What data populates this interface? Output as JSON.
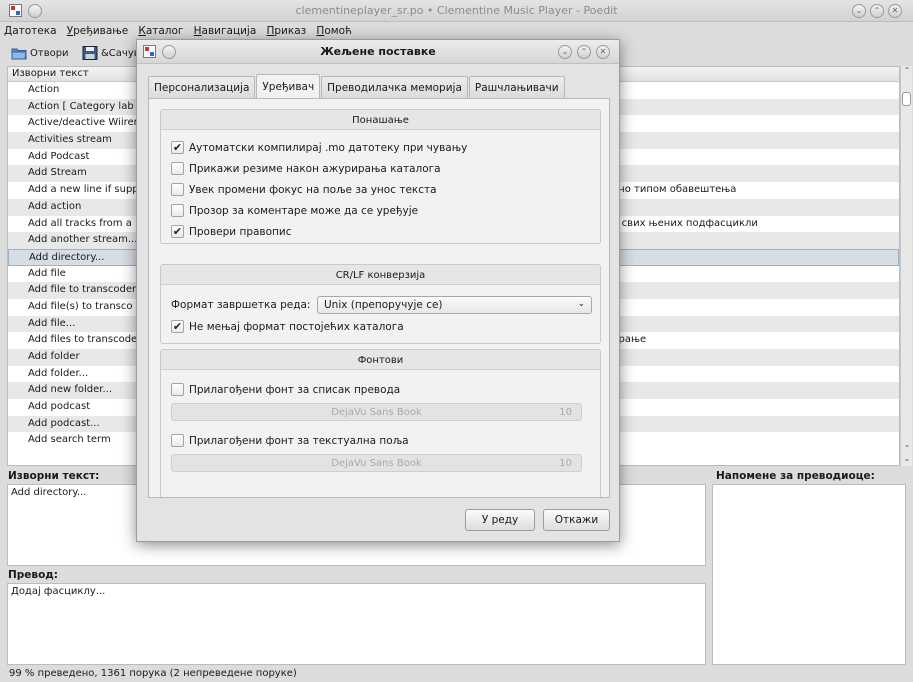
{
  "window": {
    "title": "clementineplayer_sr.po • Clementine Music Player - Poedit"
  },
  "menubar": [
    "Датотека",
    "Уређивање",
    "Каталог",
    "Навигација",
    "Приказ",
    "Помоћ"
  ],
  "toolbar": {
    "open_label": "Отвори",
    "save_label": "&Сачува"
  },
  "list": {
    "header": "Изворни текст",
    "rows": [
      "Action",
      "Action  [ Category lab",
      "Active/deactive Wiirer",
      "Activities stream",
      "Add Podcast",
      "Add Stream",
      "Add a new line if supp",
      "Add action",
      "Add all tracks from a",
      "Add another stream...",
      "Add directory...",
      "Add file",
      "Add file to transcoder",
      "Add file(s) to transco",
      "Add file...",
      "Add files to transcode",
      "Add folder",
      "Add folder...",
      "Add new folder...",
      "Add podcast",
      "Add podcast...",
      "Add search term"
    ],
    "selected_index": 10,
    "fragments": {
      "r6": "кано типом обавештења",
      "r8": "и свих њених подфасцикли",
      "r15": "ирање"
    }
  },
  "source_pane": {
    "label": "Изворни текст:",
    "text": "Add directory..."
  },
  "notes_pane": {
    "label": "Напомене за преводиоце:"
  },
  "translation_pane": {
    "label": "Превод:",
    "text": "Додај фасциклу..."
  },
  "statusbar": "99 % преведено, 1361 порука (2 непреведене поруке)",
  "dialog": {
    "title": "Жељене поставке",
    "tabs": [
      "Персонализација",
      "Уређивач",
      "Преводилачка меморија",
      "Рашчлањивачи"
    ],
    "active_tab": 1,
    "behavior": {
      "header": "Понашање",
      "options": [
        {
          "label": "Аутоматски компилирај .mo датотеку при чувању",
          "checked": true
        },
        {
          "label": "Прикажи резиме након ажурирања каталога",
          "checked": false
        },
        {
          "label": "Увек промени фокус на поље за унос текста",
          "checked": false
        },
        {
          "label": "Прозор за коментаре може да се уређује",
          "checked": false
        },
        {
          "label": "Провери правопис",
          "checked": true
        }
      ]
    },
    "crlf": {
      "header": "CR/LF конверзија",
      "format_label": "Формат завршетка реда:",
      "format_value": "Unix (препоручује се)",
      "keep_label": "Не мењај формат постојећих каталога",
      "keep_checked": true
    },
    "fonts": {
      "header": "Фонтови",
      "list_font_label": "Прилагођени фонт за списак превода",
      "list_font_checked": false,
      "list_font_name": "DejaVu Sans Book",
      "list_font_size": "10",
      "text_font_label": "Прилагођени фонт за текстуална поља",
      "text_font_checked": false,
      "text_font_name": "DejaVu Sans Book",
      "text_font_size": "10"
    },
    "ok_label": "У реду",
    "cancel_label": "Откажи"
  },
  "icons": {
    "check_mark": "✔",
    "chevron_down": "⌄",
    "minimize": "⌄",
    "maximize": "⌃",
    "close": "✕"
  }
}
